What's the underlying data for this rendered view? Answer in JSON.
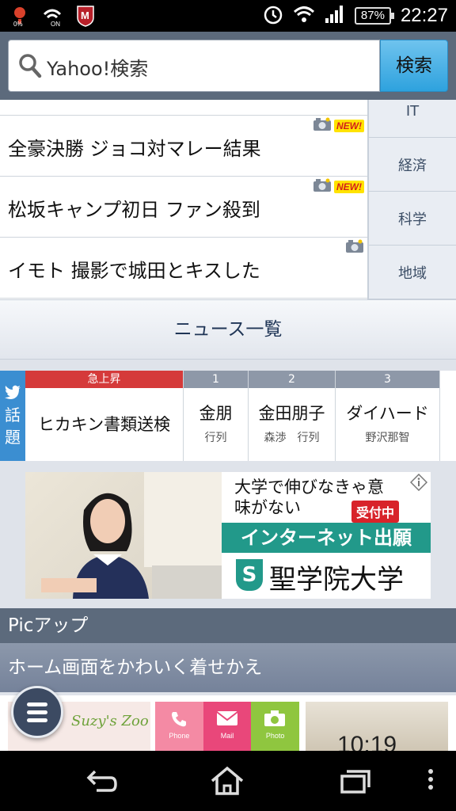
{
  "status_bar": {
    "battery_percent": "87%",
    "time": "22:27",
    "icons": [
      "notification-icon",
      "wifi-on-icon",
      "mcafee-icon",
      "alarm-icon",
      "wifi-icon",
      "signal-icon",
      "battery-icon"
    ]
  },
  "search": {
    "placeholder": "Yahoo!検索",
    "button_label": "検索"
  },
  "news": {
    "items": [
      {
        "title": "全豪決勝 ジョコ対マレー結果",
        "photo": true,
        "new": true,
        "new_label": "NEW!"
      },
      {
        "title": "松坂キャンプ初日 ファン殺到",
        "photo": true,
        "new": true,
        "new_label": "NEW!"
      },
      {
        "title": "イモト 撮影で城田とキスした",
        "photo": true,
        "new": false
      }
    ],
    "categories": [
      "IT",
      "経済",
      "科学",
      "地域"
    ],
    "more_label": "ニュース一覧"
  },
  "trends": {
    "label": [
      "話",
      "題"
    ],
    "items": [
      {
        "rank": "急上昇",
        "keyword": "ヒカキン書類送検",
        "sub": ""
      },
      {
        "rank": "1",
        "keyword": "金朋",
        "sub": "行列"
      },
      {
        "rank": "2",
        "keyword": "金田朋子",
        "sub": "森渉　行列"
      },
      {
        "rank": "3",
        "keyword": "ダイハード",
        "sub": "野沢那智"
      }
    ]
  },
  "ad": {
    "headline": "大学で伸びなきゃ意味がない",
    "badge": "受付中",
    "band": "インターネット出願",
    "logo_letter": "S",
    "name": "聖学院大学"
  },
  "pickup": {
    "header": "Picアップ",
    "subheader": "ホーム画面をかわいく着せかえ",
    "thumbs": {
      "brand": "Suzy's Zoo",
      "labels": [
        "Phone",
        "Mail",
        "Photo"
      ],
      "clock": "10:19"
    }
  },
  "colors": {
    "header_bg": "#5c6a7c",
    "search_button": "#2ea2de",
    "twitter": "#3b8ed1",
    "hot_red": "#d53a3a",
    "ad_teal": "#22998a"
  }
}
